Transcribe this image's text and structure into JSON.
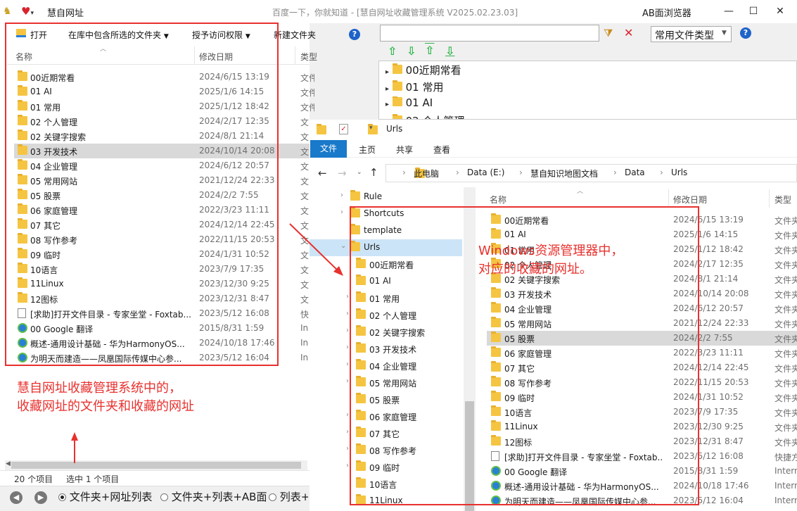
{
  "window": {
    "app_title": "慧自网址",
    "subtitle": "百度一下，你就知道 - [慧自网址收藏管理系统  V2025.02.23.03]",
    "ab_browser": "AB面浏览器",
    "minimize": "—",
    "maximize": "☐",
    "close": "✕"
  },
  "toolbar": {
    "open": "打开",
    "include_folder": "在库中包含所选的文件夹",
    "grant_access": "授予访问权限",
    "new_folder": "新建文件夹",
    "help": "?"
  },
  "left_list": {
    "columns": {
      "name": "名称",
      "date": "修改日期",
      "type": "类型"
    },
    "rows": [
      {
        "icon": "folder",
        "name": "00近期常看",
        "date": "2024/6/15 13:19",
        "type": "文件夹"
      },
      {
        "icon": "folder",
        "name": "01 AI",
        "date": "2025/1/6 14:15",
        "type": "文件夹"
      },
      {
        "icon": "folder",
        "name": "01 常用",
        "date": "2025/1/12 18:42",
        "type": "文件夹"
      },
      {
        "icon": "folder",
        "name": "02 个人管理",
        "date": "2024/2/17 12:35",
        "type": "文"
      },
      {
        "icon": "folder",
        "name": "02 关键字搜索",
        "date": "2024/8/1 21:14",
        "type": "文"
      },
      {
        "icon": "folder",
        "name": "03 开发技术",
        "date": "2024/10/14 20:08",
        "type": "文",
        "selected": true
      },
      {
        "icon": "folder",
        "name": "04 企业管理",
        "date": "2024/6/12 20:57",
        "type": "文"
      },
      {
        "icon": "folder",
        "name": "05 常用网站",
        "date": "2021/12/24 22:33",
        "type": "文"
      },
      {
        "icon": "folder",
        "name": "05 股票",
        "date": "2024/2/2 7:55",
        "type": "文"
      },
      {
        "icon": "folder",
        "name": "06 家庭管理",
        "date": "2022/3/23 11:11",
        "type": "文"
      },
      {
        "icon": "folder",
        "name": "07 其它",
        "date": "2024/12/14 22:45",
        "type": "文"
      },
      {
        "icon": "folder",
        "name": "08 写作参考",
        "date": "2022/11/15 20:53",
        "type": "文"
      },
      {
        "icon": "folder",
        "name": "09 临时",
        "date": "2024/1/31 10:52",
        "type": "文"
      },
      {
        "icon": "folder",
        "name": "10语言",
        "date": "2023/7/9 17:35",
        "type": "文"
      },
      {
        "icon": "folder",
        "name": "11Linux",
        "date": "2023/12/30 9:25",
        "type": "文"
      },
      {
        "icon": "folder",
        "name": "12图标",
        "date": "2023/12/31 8:47",
        "type": "文"
      },
      {
        "icon": "doc",
        "name": "[求助]打开文件目录 - 专家坐堂 - Foxtab...",
        "date": "2023/5/12 16:08",
        "type": "快"
      },
      {
        "icon": "globe",
        "name": "00 Google 翻译",
        "date": "2015/8/31 1:59",
        "type": "In"
      },
      {
        "icon": "globe",
        "name": "概述-通用设计基础 - 华为HarmonyOS...",
        "date": "2024/10/18 17:46",
        "type": "In"
      },
      {
        "icon": "globe",
        "name": "为明天而建造——凤凰国际传媒中心参...",
        "date": "2023/5/12 16:04",
        "type": "In"
      }
    ]
  },
  "status": {
    "count": "20 个项目",
    "selected": "选中 1 个项目"
  },
  "bottom": {
    "back": "◀",
    "forward": "▶",
    "opt1": "文件夹+网址列表",
    "opt2": "文件夹+列表+AB面",
    "opt3": "列表+"
  },
  "search": {
    "value": "",
    "type_select": "常用文件类型"
  },
  "top_tree": [
    "00近期常看",
    "01 常用",
    "01 AI",
    "02 个人管理"
  ],
  "explorer": {
    "qa_title": "Urls",
    "tabs": {
      "file": "文件",
      "home": "主页",
      "share": "共享",
      "view": "查看"
    },
    "breadcrumb": [
      "此电脑",
      "Data (E:)",
      "慧自知识地图文档",
      "Data",
      "Urls"
    ],
    "tree": [
      {
        "name": "Rule",
        "level": 0,
        "chev": "›"
      },
      {
        "name": "Shortcuts",
        "level": 0,
        "chev": "›"
      },
      {
        "name": "template",
        "level": 0,
        "chev": ""
      },
      {
        "name": "Urls",
        "level": 0,
        "chev": "⌄",
        "selected": true
      },
      {
        "name": "00近期常看",
        "level": 1,
        "chev": ""
      },
      {
        "name": "01 AI",
        "level": 1,
        "chev": ""
      },
      {
        "name": "01 常用",
        "level": 1,
        "chev": "›"
      },
      {
        "name": "02 个人管理",
        "level": 1,
        "chev": "›"
      },
      {
        "name": "02 关键字搜索",
        "level": 1,
        "chev": "›"
      },
      {
        "name": "03 开发技术",
        "level": 1,
        "chev": "›"
      },
      {
        "name": "04 企业管理",
        "level": 1,
        "chev": "›"
      },
      {
        "name": "05 常用网站",
        "level": 1,
        "chev": "›"
      },
      {
        "name": "05 股票",
        "level": 1,
        "chev": ""
      },
      {
        "name": "06 家庭管理",
        "level": 1,
        "chev": "›"
      },
      {
        "name": "07 其它",
        "level": 1,
        "chev": "›"
      },
      {
        "name": "08 写作参考",
        "level": 1,
        "chev": "›"
      },
      {
        "name": "09 临时",
        "level": 1,
        "chev": "›"
      },
      {
        "name": "10语言",
        "level": 1,
        "chev": ""
      },
      {
        "name": "11Linux",
        "level": 1,
        "chev": ""
      }
    ],
    "columns": {
      "name": "名称",
      "date": "修改日期",
      "type": "类型"
    },
    "rows": [
      {
        "icon": "folder",
        "name": "00近期常看",
        "date": "2024/6/15 13:19",
        "type": "文件夹"
      },
      {
        "icon": "folder",
        "name": "01 AI",
        "date": "2025/1/6 14:15",
        "type": "文件夹"
      },
      {
        "icon": "folder",
        "name": "01 常用",
        "date": "2025/1/12 18:42",
        "type": "文件夹"
      },
      {
        "icon": "folder",
        "name": "02 个人管理",
        "date": "2024/2/17 12:35",
        "type": "文件夹"
      },
      {
        "icon": "folder",
        "name": "02 关键字搜索",
        "date": "2024/8/1 21:14",
        "type": "文件夹"
      },
      {
        "icon": "folder",
        "name": "03 开发技术",
        "date": "2024/10/14 20:08",
        "type": "文件夹"
      },
      {
        "icon": "folder",
        "name": "04 企业管理",
        "date": "2024/6/12 20:57",
        "type": "文件夹"
      },
      {
        "icon": "folder",
        "name": "05 常用网站",
        "date": "2021/12/24 22:33",
        "type": "文件夹"
      },
      {
        "icon": "folder",
        "name": "05 股票",
        "date": "2024/2/2 7:55",
        "type": "文件夹",
        "selected": true
      },
      {
        "icon": "folder",
        "name": "06 家庭管理",
        "date": "2022/3/23 11:11",
        "type": "文件夹"
      },
      {
        "icon": "folder",
        "name": "07 其它",
        "date": "2024/12/14 22:45",
        "type": "文件夹"
      },
      {
        "icon": "folder",
        "name": "08 写作参考",
        "date": "2022/11/15 20:53",
        "type": "文件夹"
      },
      {
        "icon": "folder",
        "name": "09 临时",
        "date": "2024/1/31 10:52",
        "type": "文件夹"
      },
      {
        "icon": "folder",
        "name": "10语言",
        "date": "2023/7/9 17:35",
        "type": "文件夹"
      },
      {
        "icon": "folder",
        "name": "11Linux",
        "date": "2023/12/30 9:25",
        "type": "文件夹"
      },
      {
        "icon": "folder",
        "name": "12图标",
        "date": "2023/12/31 8:47",
        "type": "文件夹"
      },
      {
        "icon": "doc",
        "name": "[求助]打开文件目录 - 专家坐堂 - Foxtab...",
        "date": "2023/5/12 16:08",
        "type": "快捷方"
      },
      {
        "icon": "globe",
        "name": "00 Google 翻译",
        "date": "2015/8/31 1:59",
        "type": "Interne"
      },
      {
        "icon": "globe",
        "name": "概述-通用设计基础 - 华为HarmonyOS...",
        "date": "2024/10/18 17:46",
        "type": "Interne"
      },
      {
        "icon": "globe",
        "name": "为明天而建造——凤凰国际传媒中心参...",
        "date": "2023/5/12 16:04",
        "type": "Interne"
      }
    ]
  },
  "annotations": {
    "left_line1": "慧自网址收藏管理系统中的，",
    "left_line2": "收藏网址的文件夹和收藏的网址",
    "right_line1": "Windows资源管理器中，",
    "right_line2": "对应的收藏的网址。"
  },
  "colors": {
    "accent": "#1979ca",
    "annotation": "#e8312e",
    "selection": "#d9d9d9"
  }
}
